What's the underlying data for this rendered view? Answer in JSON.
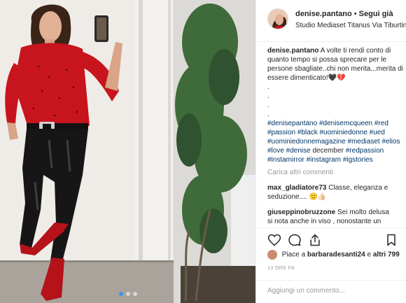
{
  "post": {
    "username": "denise.pantano",
    "separator": "•",
    "follow_label": "Segui già",
    "location": "Studio Mediaset Titanus Via Tiburtina"
  },
  "caption": {
    "username": "denise.pantano",
    "text": "A volte ti rendi conto di quanto tempo si possa sprecare per le persone sbagliate..chi non merita...merita di essere dimenticato!🖤💔",
    "dots": [
      ".",
      ".",
      ".",
      "."
    ],
    "hashtags_1": "#denisepantano #denisemcqueen #red #passion #black #uominiedonne #ued #uominiedonnemagazine #mediaset #elios #love #denise",
    "middle_text": "december",
    "hashtags_2": "#redpassion #instamirror #instagram #igstories"
  },
  "load_more": "Carica altri commenti",
  "comments": [
    {
      "username": "max_gladiatore73",
      "text": "Classe, eleganza e seduzione.... 🙂👍🏻"
    },
    {
      "username": "giuseppinobruzzone",
      "text": "Sei molto delusa si nota anche in viso , nonostante un look perfetto"
    },
    {
      "username": "",
      "text": ""
    }
  ],
  "likes": {
    "prefix": "Piace a",
    "user": "barbaradesanti24",
    "middle": "e",
    "others": "altri 799"
  },
  "timestamp": "13 ORE FA",
  "add_comment": {
    "placeholder": "Aggiungi un commento..."
  },
  "carousel": {
    "count": 3,
    "active_index": 0
  },
  "icons": {
    "like": "heart-icon",
    "comment": "comment-icon",
    "share": "share-icon",
    "save": "bookmark-icon",
    "comment_like": "heart-icon"
  },
  "colors": {
    "hashtag": "#003569",
    "carousel_active": "#3897f0",
    "muted": "#999999",
    "text": "#262626"
  }
}
